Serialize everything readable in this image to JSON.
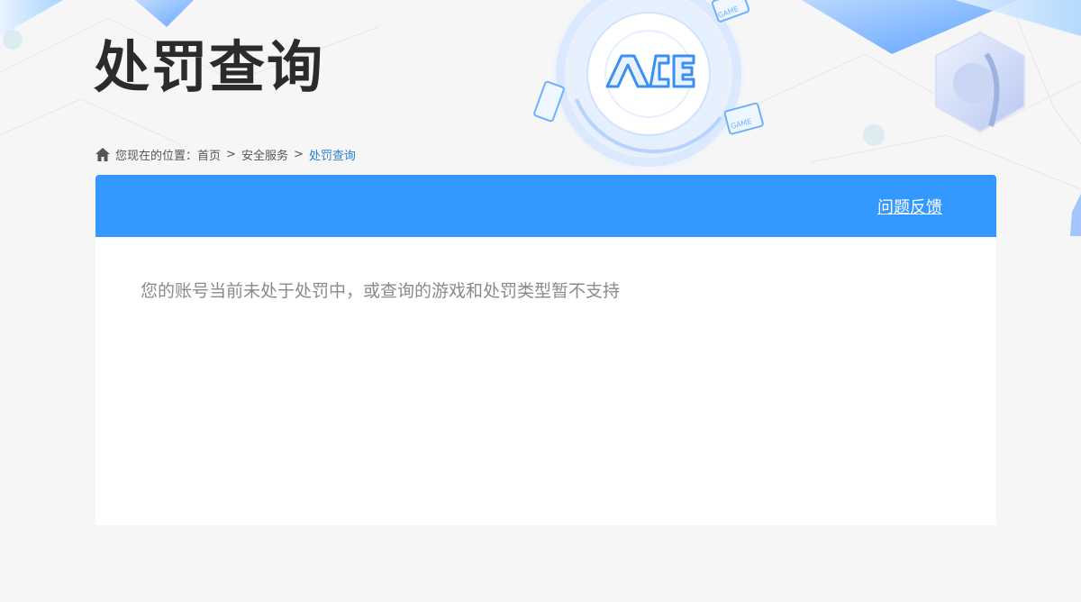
{
  "page": {
    "title": "处罚查询"
  },
  "breadcrumb": {
    "prefix": "您现在的位置：",
    "items": [
      "首页",
      "安全服务",
      "处罚查询"
    ],
    "separator": ">"
  },
  "panel": {
    "feedback_label": "问题反馈",
    "message": "您的账号当前未处于处罚中，或查询的游戏和处罚类型暂不支持"
  },
  "logo": {
    "text": "ACE"
  },
  "decor": {
    "game_label": "GAME"
  },
  "colors": {
    "header_blue": "#3399ff",
    "link_blue": "#2a7fd4",
    "title": "#2b2b2b",
    "message": "#8a8a8a",
    "background": "#f6f6f6"
  }
}
